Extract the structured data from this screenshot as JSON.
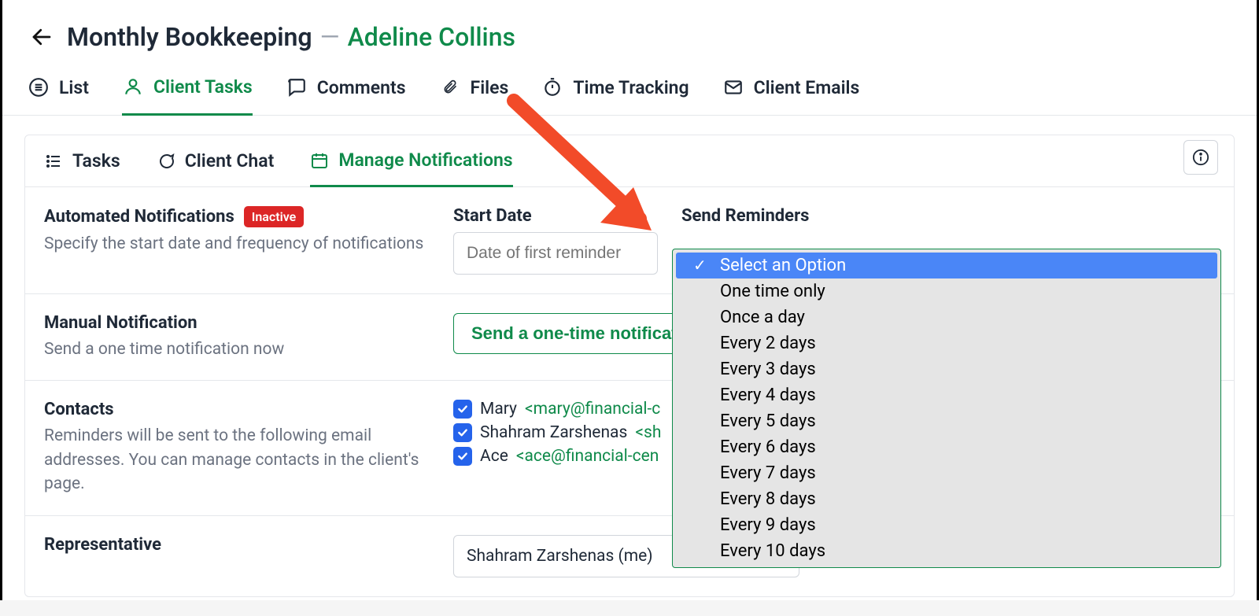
{
  "header": {
    "title": "Monthly Bookkeeping",
    "separator": "—",
    "client_name": "Adeline Collins"
  },
  "top_tabs": [
    {
      "label": "List",
      "icon": "list-lines-icon",
      "active": false
    },
    {
      "label": "Client Tasks",
      "icon": "person-icon",
      "active": true
    },
    {
      "label": "Comments",
      "icon": "speech-bubble-icon",
      "active": false
    },
    {
      "label": "Files",
      "icon": "paperclip-icon",
      "active": false
    },
    {
      "label": "Time Tracking",
      "icon": "stopwatch-icon",
      "active": false
    },
    {
      "label": "Client Emails",
      "icon": "envelope-icon",
      "active": false
    }
  ],
  "sub_tabs": [
    {
      "label": "Tasks",
      "icon": "task-list-icon",
      "active": false
    },
    {
      "label": "Client Chat",
      "icon": "chat-bubble-icon",
      "active": false
    },
    {
      "label": "Manage Notifications",
      "icon": "calendar-icon",
      "active": true
    }
  ],
  "sections": {
    "automated": {
      "title": "Automated Notifications",
      "badge": "Inactive",
      "description": "Specify the start date and frequency of notifications",
      "start_date_label": "Start Date",
      "start_date_placeholder": "Date of first reminder",
      "reminders_label": "Send Reminders"
    },
    "manual": {
      "title": "Manual Notification",
      "description": "Send a one time notification now",
      "button_label": "Send a one-time notification to the client now"
    },
    "contacts": {
      "title": "Contacts",
      "description": "Reminders will be sent to the following email addresses. You can manage contacts in the client's page.",
      "list": [
        {
          "name": "Mary ",
          "email": "<mary@financial-c"
        },
        {
          "name": "Shahram Zarshenas ",
          "email": "<sh"
        },
        {
          "name": "Ace ",
          "email": "<ace@financial-cen"
        }
      ]
    },
    "representative": {
      "title": "Representative",
      "selected": "Shahram Zarshenas (me)"
    }
  },
  "dropdown": {
    "options": [
      "Select an Option",
      "One time only",
      "Once a day",
      "Every 2 days",
      "Every 3 days",
      "Every 4 days",
      "Every 5 days",
      "Every 6 days",
      "Every 7 days",
      "Every 8 days",
      "Every 9 days",
      "Every 10 days"
    ],
    "selected_index": 0
  },
  "colors": {
    "accent_green": "#0f8a4a",
    "badge_red": "#dc2626",
    "option_highlight": "#4a86f7",
    "checkbox_blue": "#2563eb",
    "arrow_red": "#f24b29"
  }
}
